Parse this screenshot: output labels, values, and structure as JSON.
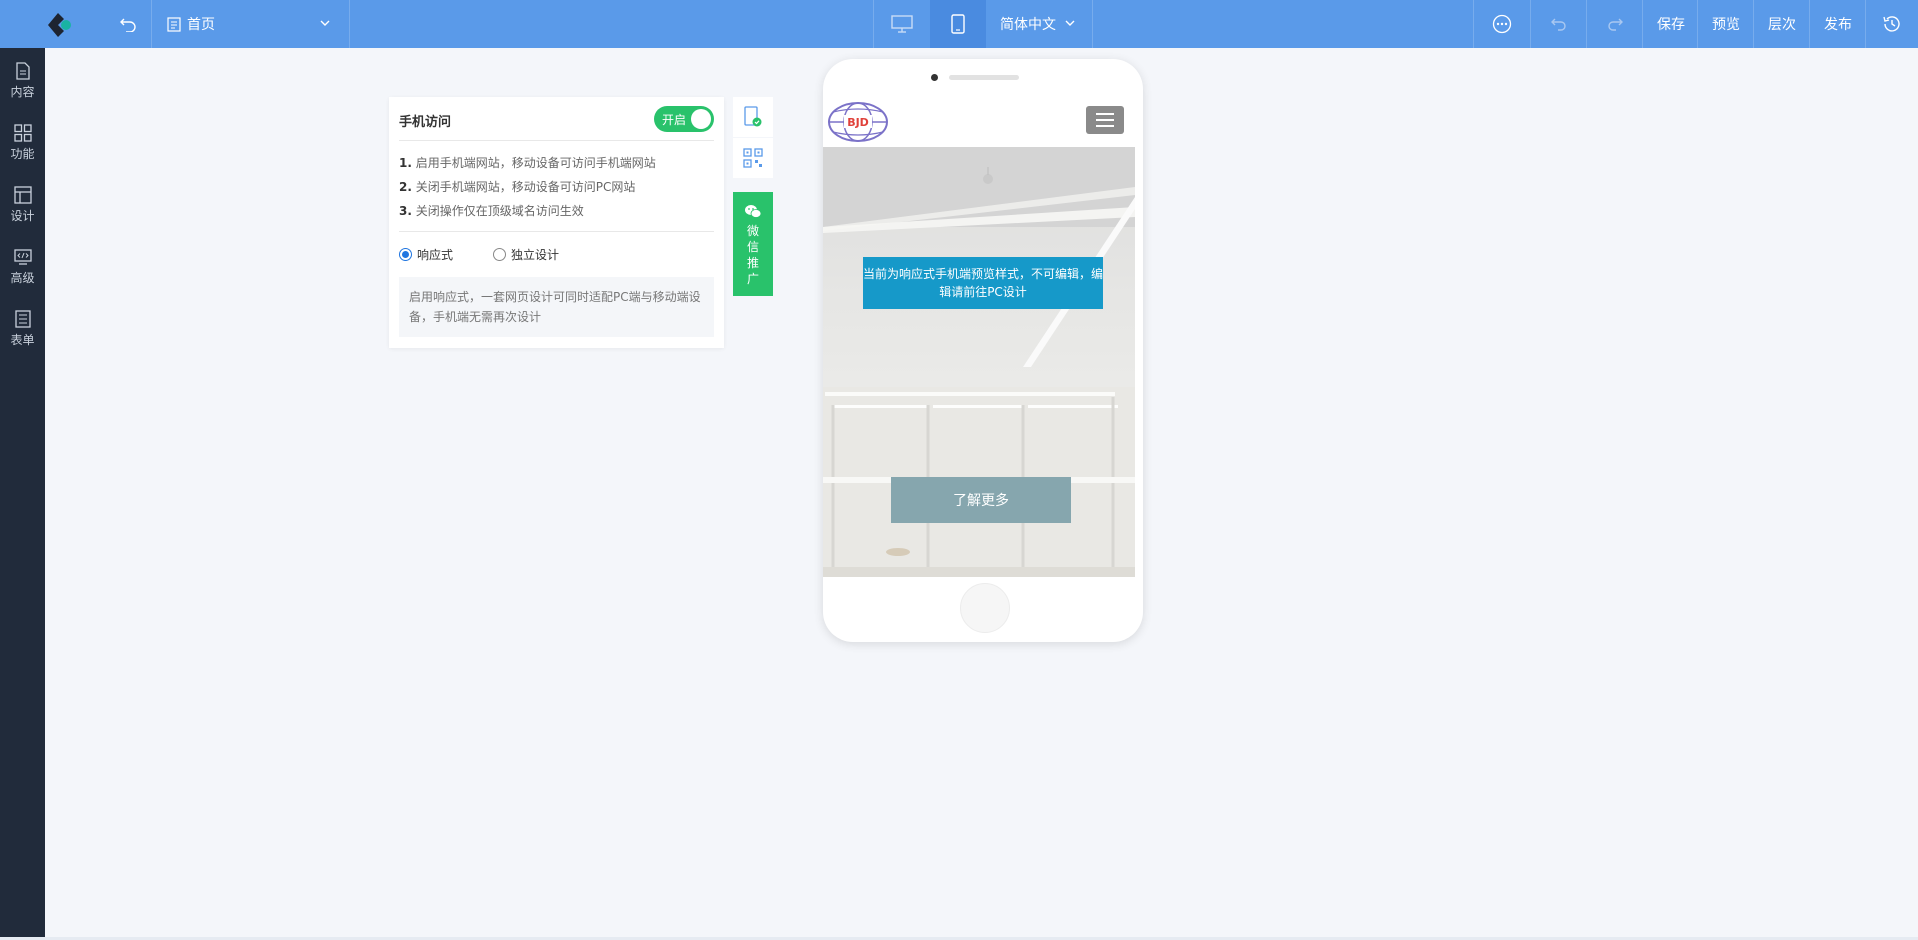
{
  "topbar": {
    "page_name": "首页",
    "language": "简体中文",
    "save_label": "保存",
    "preview_label": "预览",
    "layers_label": "层次",
    "publish_label": "发布"
  },
  "sidebar": {
    "items": [
      {
        "label": "内容",
        "icon": "file-icon"
      },
      {
        "label": "功能",
        "icon": "grid-icon"
      },
      {
        "label": "设计",
        "icon": "layout-icon"
      },
      {
        "label": "高级",
        "icon": "code-icon"
      },
      {
        "label": "表单",
        "icon": "form-icon"
      }
    ]
  },
  "panel": {
    "title": "手机访问",
    "toggle_label": "开启",
    "toggle_on": true,
    "rules": [
      {
        "num": "1.",
        "text": "启用手机端网站，移动设备可访问手机端网站"
      },
      {
        "num": "2.",
        "text": "关闭手机端网站，移动设备可访问PC网站"
      },
      {
        "num": "3.",
        "text": "关闭操作仅在顶级域名访问生效"
      }
    ],
    "options": [
      {
        "label": "响应式",
        "selected": true
      },
      {
        "label": "独立设计",
        "selected": false
      }
    ],
    "description": "启用响应式，一套网页设计可同时适配PC端与移动端设备，手机端无需再次设计"
  },
  "wechat": {
    "chars": [
      "微",
      "信",
      "推",
      "广"
    ]
  },
  "phone": {
    "logo_text": "BJD",
    "notice": "当前为响应式手机端预览样式，不可编辑，编辑请前往PC设计",
    "learn_more": "了解更多"
  },
  "colors": {
    "topbar": "#5a9ae9",
    "sidebar": "#212b3b",
    "green": "#29c26b",
    "notice": "#1699c9",
    "button": "#86a6ae"
  }
}
